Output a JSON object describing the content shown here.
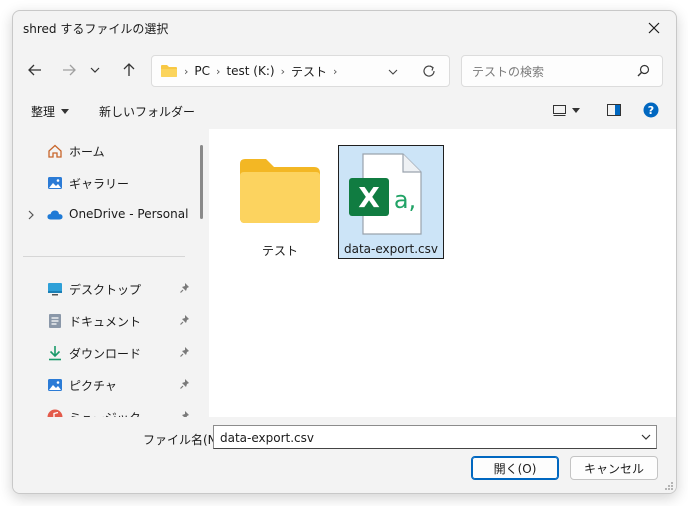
{
  "window": {
    "title": "shred するファイルの選択",
    "close_icon": "close-icon"
  },
  "nav": {
    "back_icon": "arrow-left-icon",
    "forward_icon": "arrow-right-icon",
    "recent_icon": "chevron-down-icon",
    "up_icon": "arrow-up-icon",
    "breadcrumbs": [
      "PC",
      "test (K:)",
      "テスト"
    ],
    "refresh_icon": "refresh-icon",
    "search_placeholder": "テストの検索"
  },
  "toolbar": {
    "organize_label": "整理",
    "new_folder_label": "新しいフォルダー"
  },
  "sidebar": {
    "top_items": [
      {
        "label": "ホーム",
        "icon": "home-icon"
      },
      {
        "label": "ギャラリー",
        "icon": "gallery-icon"
      },
      {
        "label": "OneDrive - Personal",
        "icon": "cloud-icon"
      }
    ],
    "pinned_items": [
      {
        "label": "デスクトップ",
        "icon": "desktop-icon"
      },
      {
        "label": "ドキュメント",
        "icon": "document-icon"
      },
      {
        "label": "ダウンロード",
        "icon": "download-icon"
      },
      {
        "label": "ピクチャ",
        "icon": "pictures-icon"
      },
      {
        "label": "ミュージック",
        "icon": "music-icon"
      }
    ]
  },
  "files": [
    {
      "name": "テスト",
      "type": "folder"
    },
    {
      "name": "data-export.csv",
      "type": "csv",
      "selected": true
    }
  ],
  "bottom": {
    "filename_label": "ファイル名(N):",
    "filename_value": "data-export.csv",
    "open_label": "開く(O)",
    "cancel_label": "キャンセル"
  },
  "colors": {
    "accent": "#0067c0",
    "selection": "#cce4f7",
    "folder": "#f8c844",
    "excel": "#107c41"
  }
}
